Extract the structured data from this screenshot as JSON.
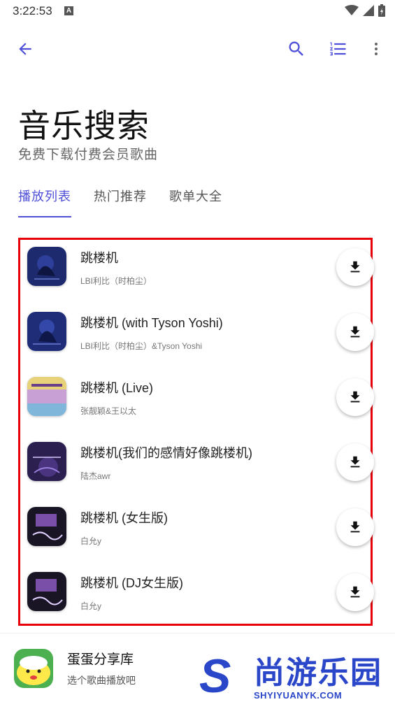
{
  "status_bar": {
    "time": "3:22:53",
    "a_badge": "A"
  },
  "app_bar": {
    "accent_color": "#4f4fd8",
    "icons": [
      "back-arrow-icon",
      "search-icon",
      "numbered-list-icon",
      "more-vert-icon"
    ]
  },
  "header": {
    "title": "音乐搜索",
    "subtitle": "免费下载付费会员歌曲"
  },
  "tabs": [
    {
      "label": "播放列表",
      "active": true
    },
    {
      "label": "热门推荐",
      "active": false
    },
    {
      "label": "歌单大全",
      "active": false
    }
  ],
  "songs": [
    {
      "title": "跳楼机",
      "artist": "LBI利比（时柏尘）",
      "cover": "blue"
    },
    {
      "title": "跳楼机 (with Tyson Yoshi)",
      "artist": "LBI利比（时柏尘）&Tyson Yoshi",
      "cover": "blue"
    },
    {
      "title": "跳楼机 (Live)",
      "artist": "张靓颖&王以太",
      "cover": "colorful"
    },
    {
      "title": "跳楼机(我们的感情好像跳楼机)",
      "artist": "陆杰awr",
      "cover": "purple"
    },
    {
      "title": "跳楼机 (女生版)",
      "artist": "白允y",
      "cover": "dark"
    },
    {
      "title": "跳楼机 (DJ女生版)",
      "artist": "白允y",
      "cover": "dark"
    }
  ],
  "highlight_color": "#e8000b",
  "bottom_bar": {
    "app_name": "蛋蛋分享库",
    "hint": "选个歌曲播放吧"
  },
  "watermark": {
    "letter": "S",
    "text": "尚游乐园",
    "url": "SHYIYUANYK.COM"
  }
}
